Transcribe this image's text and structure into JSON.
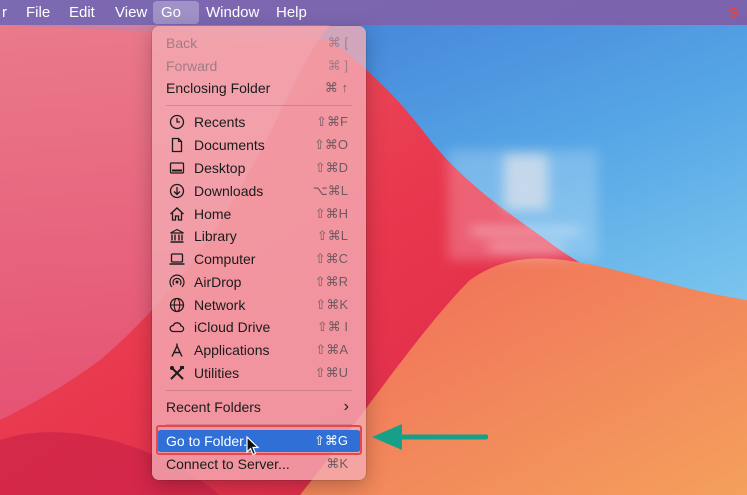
{
  "menubar": {
    "items": [
      "File",
      "Edit",
      "View",
      "Go",
      "Window",
      "Help"
    ],
    "active": "Go"
  },
  "go_menu": {
    "nav": [
      {
        "label": "Back",
        "shortcut": "⌘ [",
        "disabled": true
      },
      {
        "label": "Forward",
        "shortcut": "⌘ ]",
        "disabled": true
      },
      {
        "label": "Enclosing Folder",
        "shortcut": "⌘ ↑",
        "disabled": false
      }
    ],
    "places": [
      {
        "label": "Recents",
        "shortcut": "⇧⌘F",
        "icon": "clock-icon"
      },
      {
        "label": "Documents",
        "shortcut": "⇧⌘O",
        "icon": "document-icon"
      },
      {
        "label": "Desktop",
        "shortcut": "⇧⌘D",
        "icon": "desktop-icon"
      },
      {
        "label": "Downloads",
        "shortcut": "⌥⌘L",
        "icon": "download-icon"
      },
      {
        "label": "Home",
        "shortcut": "⇧⌘H",
        "icon": "home-icon"
      },
      {
        "label": "Library",
        "shortcut": "⇧⌘L",
        "icon": "library-icon"
      },
      {
        "label": "Computer",
        "shortcut": "⇧⌘C",
        "icon": "computer-icon"
      },
      {
        "label": "AirDrop",
        "shortcut": "⇧⌘R",
        "icon": "airdrop-icon"
      },
      {
        "label": "Network",
        "shortcut": "⇧⌘K",
        "icon": "network-icon"
      },
      {
        "label": "iCloud Drive",
        "shortcut": "⇧⌘ I",
        "icon": "cloud-icon"
      },
      {
        "label": "Applications",
        "shortcut": "⇧⌘A",
        "icon": "applications-icon"
      },
      {
        "label": "Utilities",
        "shortcut": "⇧⌘U",
        "icon": "utilities-icon"
      }
    ],
    "recent_folders": "Recent Folders",
    "go_to_folder": {
      "label": "Go to Folder...",
      "shortcut": "⇧⌘G"
    },
    "connect_to_server": {
      "label": "Connect to Server...",
      "shortcut": "⌘K"
    }
  },
  "colors": {
    "highlight": "#2f6fd6",
    "annotation_box": "#e8474c",
    "annotation_arrow": "#16a08a"
  }
}
